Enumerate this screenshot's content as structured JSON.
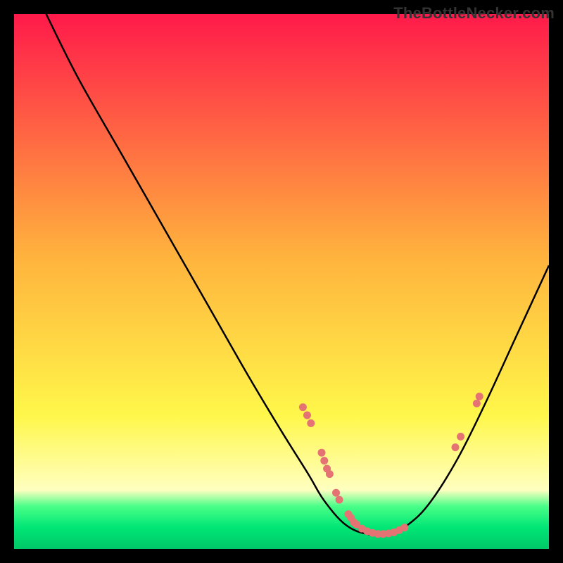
{
  "watermark": "TheBottleNecker.com",
  "chart_data": {
    "type": "line",
    "title": "",
    "xlabel": "",
    "ylabel": "",
    "xlim": [
      0,
      100
    ],
    "ylim": [
      0,
      100
    ],
    "grid": false,
    "legend": false,
    "background_gradient": {
      "top": {
        "hex": "#ff1a4a",
        "pos": 0
      },
      "upper_mid": {
        "hex": "#ffb23d",
        "pos": 45
      },
      "mid": {
        "hex": "#fff74a",
        "pos": 75
      },
      "pale": {
        "hex": "#ffffc0",
        "pos": 89
      },
      "green_top": {
        "hex": "#4aff88",
        "pos": 92
      },
      "green_mid": {
        "hex": "#00e676",
        "pos": 96
      },
      "green_bot": {
        "hex": "#00c868",
        "pos": 100
      }
    },
    "curve": {
      "name": "bottleneck-curve",
      "color": "#000000",
      "width": 2.5,
      "notes": "Y values are percent of plot height from top (0=top, 100=bottom). Minimum around x≈68.",
      "points": [
        {
          "x": 6,
          "y": 0
        },
        {
          "x": 12,
          "y": 12
        },
        {
          "x": 20,
          "y": 26
        },
        {
          "x": 28,
          "y": 40
        },
        {
          "x": 36,
          "y": 54
        },
        {
          "x": 44,
          "y": 68
        },
        {
          "x": 50,
          "y": 78
        },
        {
          "x": 55,
          "y": 86
        },
        {
          "x": 58,
          "y": 91
        },
        {
          "x": 62,
          "y": 95.5
        },
        {
          "x": 66,
          "y": 97.2
        },
        {
          "x": 70,
          "y": 97.2
        },
        {
          "x": 74,
          "y": 95.2
        },
        {
          "x": 78,
          "y": 91
        },
        {
          "x": 83,
          "y": 83
        },
        {
          "x": 88,
          "y": 73
        },
        {
          "x": 94,
          "y": 60
        },
        {
          "x": 100,
          "y": 47
        }
      ]
    },
    "dot_series": {
      "name": "benchmark-dots",
      "color": "#e57373",
      "radius": 5.5,
      "points": [
        {
          "x": 54.0,
          "y": 73.5
        },
        {
          "x": 54.8,
          "y": 75.0
        },
        {
          "x": 55.5,
          "y": 76.5
        },
        {
          "x": 57.5,
          "y": 82.0
        },
        {
          "x": 58.0,
          "y": 83.5
        },
        {
          "x": 58.5,
          "y": 85.0
        },
        {
          "x": 59.0,
          "y": 86.0
        },
        {
          "x": 60.2,
          "y": 89.5
        },
        {
          "x": 60.8,
          "y": 90.8
        },
        {
          "x": 62.5,
          "y": 93.5
        },
        {
          "x": 63.0,
          "y": 94.2
        },
        {
          "x": 63.5,
          "y": 95.0
        },
        {
          "x": 64.0,
          "y": 95.4
        },
        {
          "x": 65.0,
          "y": 96.2
        },
        {
          "x": 66.0,
          "y": 96.7
        },
        {
          "x": 67.0,
          "y": 97.0
        },
        {
          "x": 68.0,
          "y": 97.2
        },
        {
          "x": 69.0,
          "y": 97.2
        },
        {
          "x": 70.0,
          "y": 97.1
        },
        {
          "x": 71.0,
          "y": 96.9
        },
        {
          "x": 72.0,
          "y": 96.5
        },
        {
          "x": 73.0,
          "y": 96.0
        },
        {
          "x": 82.5,
          "y": 81.0
        },
        {
          "x": 83.5,
          "y": 79.0
        },
        {
          "x": 86.5,
          "y": 72.8
        },
        {
          "x": 87.0,
          "y": 71.5
        }
      ]
    }
  }
}
